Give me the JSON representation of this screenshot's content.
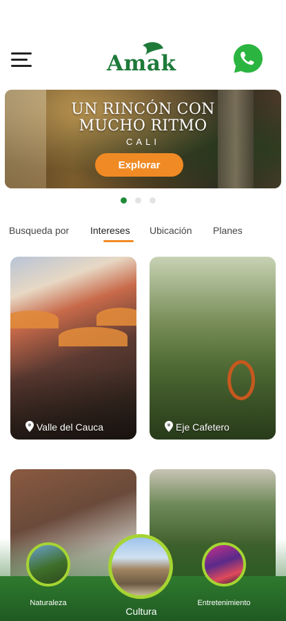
{
  "header": {
    "logo_text": "Amak",
    "menu_icon": "hamburger-menu-icon",
    "whatsapp_icon": "whatsapp-icon",
    "brand_color": "#1f7a3a"
  },
  "hero": {
    "title_line1": "UN RINCÓN CON",
    "title_line2": "MUCHO RITMO",
    "subtitle": "CALI",
    "button_label": "Explorar",
    "button_color": "#f08a24"
  },
  "carousel": {
    "total": 3,
    "active_index": 0
  },
  "tabs": {
    "items": [
      "Busqueda por",
      "Intereses",
      "Ubicación",
      "Planes"
    ],
    "active": "Intereses",
    "accent_color": "#f08a24"
  },
  "cards": [
    {
      "label": "Valle del Cauca",
      "icon": "location-pin-icon"
    },
    {
      "label": "Eje Cafetero",
      "icon": "location-pin-icon"
    },
    {
      "label": "",
      "icon": ""
    },
    {
      "label": "",
      "icon": ""
    }
  ],
  "bottom_nav": {
    "items": [
      {
        "label": "Naturaleza"
      },
      {
        "label": "Cultura",
        "selected": true
      },
      {
        "label": "Entretenimiento"
      }
    ],
    "background": "#1f5a22",
    "ring_color": "#a6d432"
  }
}
